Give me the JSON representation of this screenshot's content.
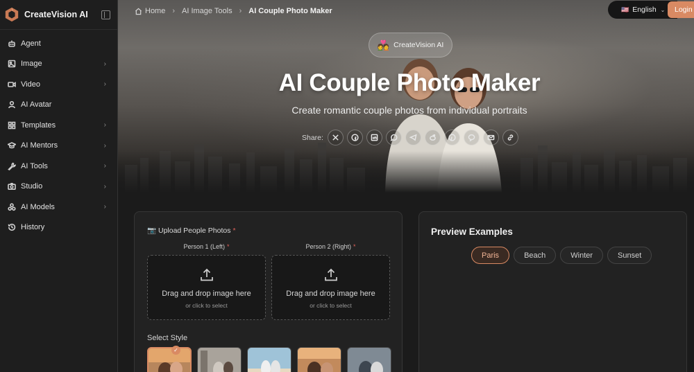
{
  "brand": {
    "name": "CreateVision AI"
  },
  "sidebar": {
    "items": [
      {
        "label": "Agent",
        "icon": "robot-icon",
        "has_submenu": false
      },
      {
        "label": "Image",
        "icon": "image-icon",
        "has_submenu": true
      },
      {
        "label": "Video",
        "icon": "video-icon",
        "has_submenu": true
      },
      {
        "label": "AI Avatar",
        "icon": "user-icon",
        "has_submenu": false
      },
      {
        "label": "Templates",
        "icon": "grid-icon",
        "has_submenu": true
      },
      {
        "label": "AI Mentors",
        "icon": "graduation-cap-icon",
        "has_submenu": true
      },
      {
        "label": "AI Tools",
        "icon": "wrench-icon",
        "has_submenu": true
      },
      {
        "label": "Studio",
        "icon": "camera-icon",
        "has_submenu": true
      },
      {
        "label": "AI Models",
        "icon": "models-icon",
        "has_submenu": true
      },
      {
        "label": "History",
        "icon": "history-icon",
        "has_submenu": false
      }
    ]
  },
  "breadcrumb": {
    "home": "Home",
    "section": "AI Image Tools",
    "current": "AI Couple Photo Maker"
  },
  "header": {
    "language": "English",
    "language_flag": "🇺🇸",
    "login": "Login"
  },
  "hero": {
    "badge_emoji": "💑",
    "badge_text": "CreateVision AI",
    "title": "AI Couple Photo Maker",
    "subtitle": "Create romantic couple photos from individual portraits",
    "share_label": "Share:",
    "share_icons": [
      "x-icon",
      "facebook-icon",
      "linkedin-icon",
      "whatsapp-icon",
      "telegram-icon",
      "reddit-icon",
      "pinterest-icon",
      "line-icon",
      "email-icon",
      "link-icon"
    ]
  },
  "upload": {
    "title": "📷 Upload People Photos",
    "required_mark": "*",
    "person1_label": "Person 1 (Left)",
    "person2_label": "Person 2 (Right)",
    "drop_main": "Drag and drop image here",
    "drop_sub": "or click to select",
    "style_label": "Select Style",
    "check_mark": "✓"
  },
  "preview": {
    "title": "Preview Examples",
    "tabs": [
      "Paris",
      "Beach",
      "Winter",
      "Sunset"
    ],
    "active_tab": "Paris"
  },
  "colors": {
    "accent": "#d98a63",
    "background": "#1b1b1b",
    "panel": "#222222"
  }
}
